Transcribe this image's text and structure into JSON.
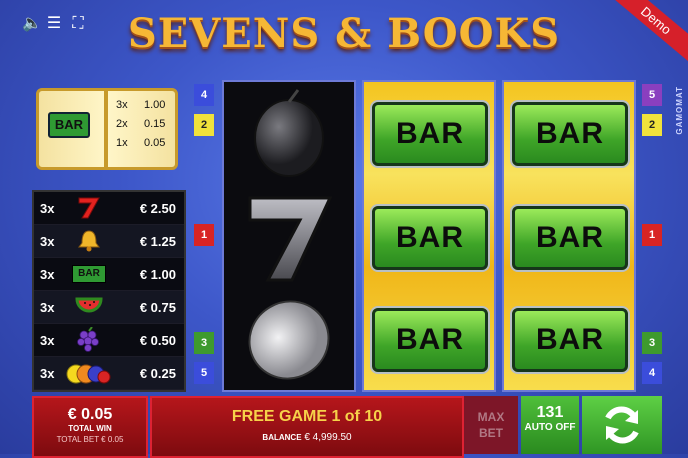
{
  "header": {
    "title": "SEVENS & BOOKS",
    "demo_label": "Demo",
    "vendor": "GAMOMAT",
    "icons": [
      "speaker-icon",
      "menu-icon",
      "fullscreen-icon"
    ]
  },
  "book": {
    "symbol": "BAR",
    "rows": [
      {
        "mult": "3x",
        "value": "1.00"
      },
      {
        "mult": "2x",
        "value": "0.15"
      },
      {
        "mult": "1x",
        "value": "0.05"
      }
    ]
  },
  "paytable": [
    {
      "mult": "3x",
      "symbol": "seven",
      "amount": "€ 2.50"
    },
    {
      "mult": "3x",
      "symbol": "bell",
      "amount": "€ 1.25"
    },
    {
      "mult": "3x",
      "symbol": "bar",
      "amount": "€ 1.00"
    },
    {
      "mult": "3x",
      "symbol": "watermelon",
      "amount": "€ 0.75"
    },
    {
      "mult": "3x",
      "symbol": "grapes",
      "amount": "€ 0.50"
    },
    {
      "mult": "3x",
      "symbol": "mixed-fruit",
      "amount": "€ 0.25"
    }
  ],
  "paytable_bar_label": "BAR",
  "line_markers": {
    "left": [
      {
        "label": "4",
        "color": "blue"
      },
      {
        "label": "2",
        "color": "yellow"
      },
      {
        "label": "1",
        "color": "red"
      },
      {
        "label": "3",
        "color": "green"
      },
      {
        "label": "5",
        "color": "blue"
      }
    ],
    "right": [
      {
        "label": "5",
        "color": "purple"
      },
      {
        "label": "2",
        "color": "yellow"
      },
      {
        "label": "1",
        "color": "red"
      },
      {
        "label": "3",
        "color": "green"
      },
      {
        "label": "4",
        "color": "blue"
      }
    ]
  },
  "reels": {
    "reel1": [
      "plum",
      "seven",
      "lemon"
    ],
    "reel2": [
      "BAR",
      "BAR",
      "BAR"
    ],
    "reel3": [
      "BAR",
      "BAR",
      "BAR"
    ]
  },
  "bottom": {
    "total_win_value": "€ 0.05",
    "total_win_label": "TOTAL WIN",
    "total_bet": "TOTAL BET € 0.05",
    "free_game": "FREE GAME 1 of 10",
    "balance_label": "BALANCE",
    "balance_value": "€ 4,999.50",
    "max_bet_line1": "MAX",
    "max_bet_line2": "BET",
    "auto_count": "131",
    "auto_label": "AUTO OFF"
  },
  "colors": {
    "background": "#3d57c9",
    "gold": "#f6b735",
    "panel_red": "#b5161b",
    "spin_green": "#4fbf3a"
  }
}
